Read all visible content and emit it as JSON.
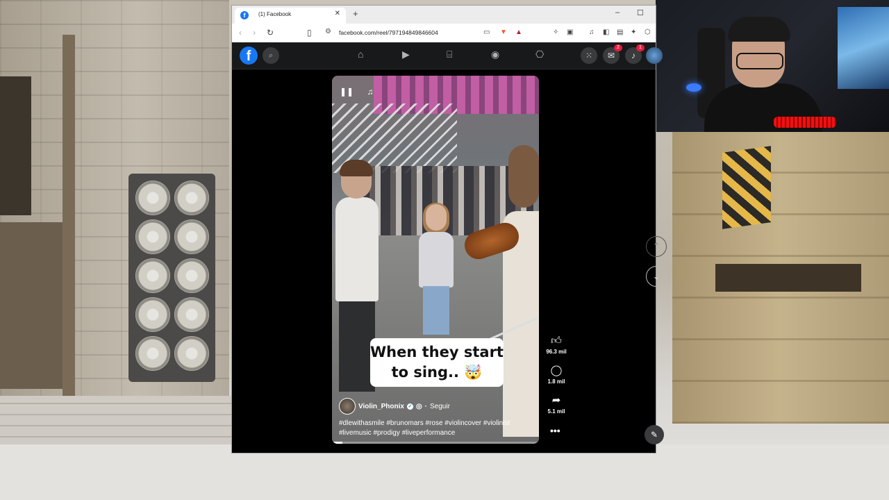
{
  "browser": {
    "tab_title": "(1) Facebook",
    "tab_favicon": "f",
    "new_tab": "+",
    "url": "facebook.com/reel/797194849846604",
    "minimize": "–",
    "maximize": "☐",
    "close": "✕"
  },
  "facebook": {
    "logo": "f",
    "messenger_badge": "2",
    "notifications_badge": "1"
  },
  "reel": {
    "caption_line1": "When they start",
    "caption_line2": "to sing.. 🤯",
    "author": "Violin_Phonix",
    "follow": "Seguir",
    "hashtags_line1": "#dlewithasmile #brunomars #rose #violincover #violinist",
    "hashtags_line2": "#livemusic #prodigy #liveperformance",
    "progress": 0.05
  },
  "actions": {
    "likes": "96.3 mil",
    "comments": "1.8 mil",
    "shares": "5.1 mil",
    "more": "•••"
  },
  "colors": {
    "facebook_blue": "#1877f2",
    "fb_bar": "#18191a",
    "badge_red": "#e41e3f"
  }
}
